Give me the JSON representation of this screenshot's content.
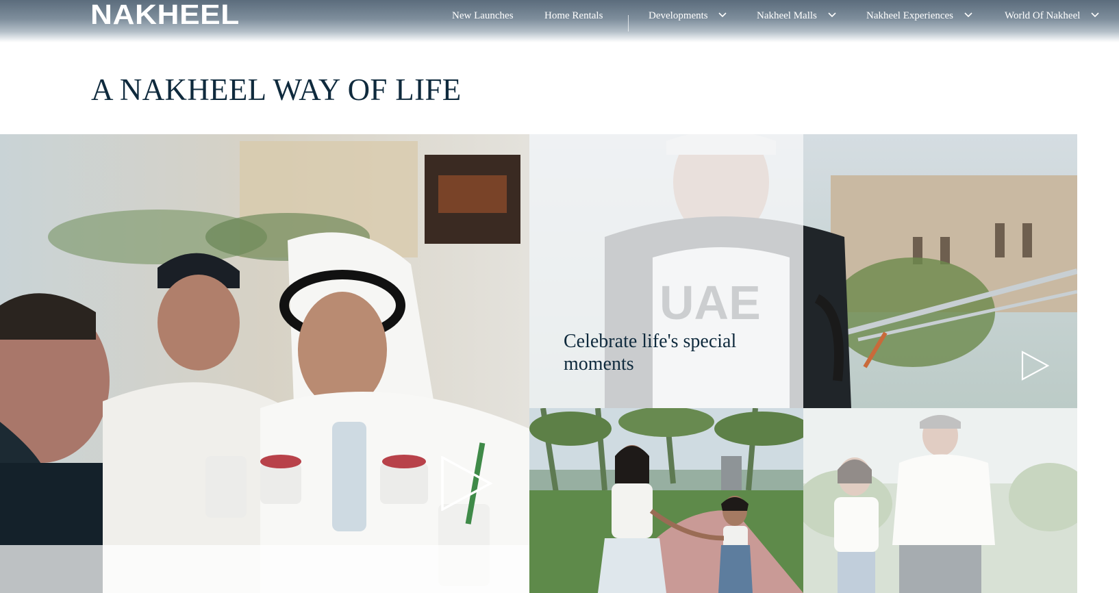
{
  "header": {
    "logo_text": "NAKHEEL",
    "nav": [
      {
        "label": "New Launches",
        "has_dropdown": false
      },
      {
        "label": "Home Rentals",
        "has_dropdown": false
      },
      {
        "label": "Developments",
        "has_dropdown": true
      },
      {
        "label": "Nakheel Malls",
        "has_dropdown": true
      },
      {
        "label": "Nakheel Experiences",
        "has_dropdown": true
      },
      {
        "label": "World Of Nakheel",
        "has_dropdown": true
      }
    ]
  },
  "main": {
    "title": "A NAKHEEL WAY OF LIFE",
    "tiles": {
      "cyclist_caption": "Celebrate life's special moments"
    }
  },
  "icons": {
    "play": "play-icon",
    "chevron": "chevron-down-icon"
  },
  "colors": {
    "title": "#0f2a3d",
    "header_top": "#5b6c7c"
  }
}
